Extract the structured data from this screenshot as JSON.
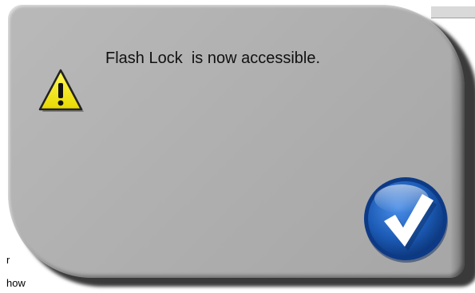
{
  "background": {
    "fragment_line_1": "r",
    "fragment_line_2": "how"
  },
  "dialog": {
    "message": "Flash Lock  is now accessible.",
    "warning_icon": "warning-triangle-icon",
    "ok_icon": "checkmark-circle-icon"
  },
  "colors": {
    "dialog_bg": "#b3b3b3",
    "warning_yellow": "#f5ee00",
    "button_blue": "#1f5fb8"
  }
}
